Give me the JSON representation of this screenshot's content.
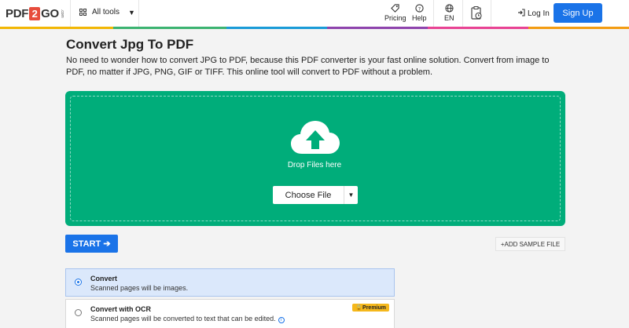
{
  "header": {
    "logo": {
      "pdf": "PDF",
      "two": "2",
      "go": "GO",
      "com": ".com"
    },
    "all_tools": "All tools",
    "nav": [
      {
        "label": "Pricing",
        "icon": "tag-icon"
      },
      {
        "label": "Help",
        "icon": "question-icon"
      },
      {
        "label": "EN",
        "icon": "globe-icon"
      }
    ],
    "login": "Log In",
    "signup": "Sign Up"
  },
  "page": {
    "title": "Convert Jpg To PDF",
    "description": "No need to wonder how to convert JPG to PDF, because this PDF converter is your fast online solution. Convert from image to PDF, no matter if JPG, PNG, GIF or TIFF. This online tool will convert to PDF without a problem."
  },
  "dropzone": {
    "label": "Drop Files here",
    "choose_file": "Choose File",
    "color": "#00ad7a"
  },
  "actions": {
    "start": "START",
    "add_sample": "ADD SAMPLE FILE"
  },
  "options": [
    {
      "title": "Convert",
      "desc": "Scanned pages will be images.",
      "selected": true
    },
    {
      "title": "Convert with OCR",
      "desc": "Scanned pages will be converted to text that can be edited.",
      "badge": "Premium",
      "selected": false
    }
  ],
  "colors": {
    "accent": "#1a73e8",
    "green": "#00ad7a",
    "premium": "#f5b81c"
  }
}
